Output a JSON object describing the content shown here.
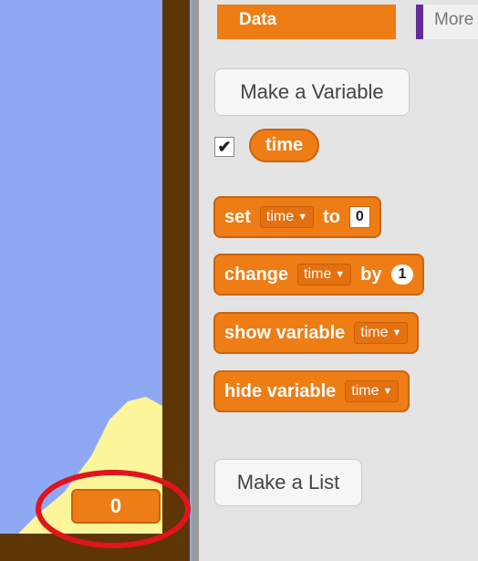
{
  "stage": {
    "readout_value": "0",
    "colors": {
      "sky": "#8fa8f4",
      "wall": "#5e3505",
      "sand": "#fdf59a",
      "highlight": "#e0141c"
    }
  },
  "palette": {
    "category_active": "Data",
    "category_next": "More",
    "make_variable_label": "Make a Variable",
    "variable": {
      "name": "time",
      "checked": true,
      "check_glyph": "✔"
    },
    "blocks": {
      "set": {
        "label": "set",
        "var": "time",
        "to": "to",
        "value": "0"
      },
      "change": {
        "label": "change",
        "var": "time",
        "by": "by",
        "value": "1"
      },
      "show": {
        "label": "show variable",
        "var": "time"
      },
      "hide": {
        "label": "hide variable",
        "var": "time"
      }
    },
    "make_list_label": "Make a List",
    "colors": {
      "data_orange": "#ee7d16",
      "more_purple": "#632d99"
    }
  }
}
